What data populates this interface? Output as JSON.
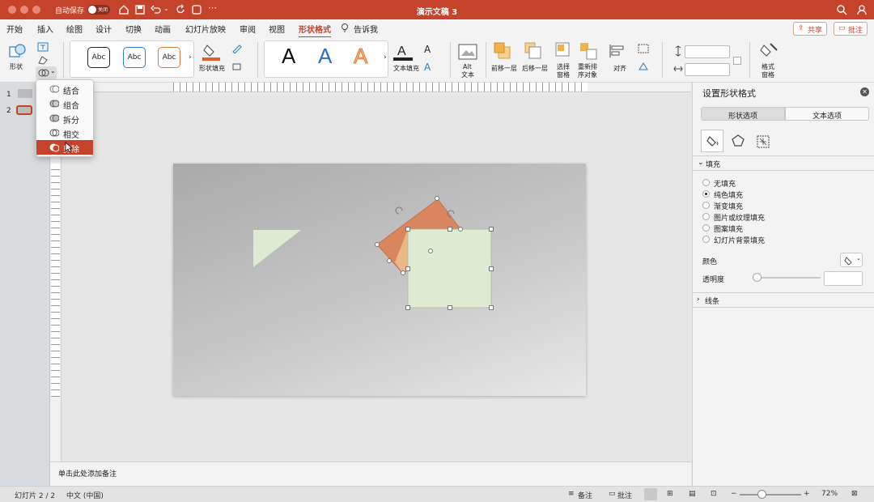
{
  "titlebar": {
    "autosave_label": "自动保存",
    "autosave_toggle": "关闭",
    "title": "演示文稿 3"
  },
  "tabs": [
    {
      "label": "开始"
    },
    {
      "label": "插入"
    },
    {
      "label": "绘图"
    },
    {
      "label": "设计"
    },
    {
      "label": "切换"
    },
    {
      "label": "动画"
    },
    {
      "label": "幻灯片放映"
    },
    {
      "label": "审阅"
    },
    {
      "label": "视图"
    },
    {
      "label": "形状格式"
    },
    {
      "label": "告诉我"
    }
  ],
  "header_actions": {
    "share": "共享",
    "comments": "批注"
  },
  "ribbon": {
    "shapes_label": "形状",
    "style_abc": [
      "Abc",
      "Abc",
      "Abc"
    ],
    "shape_fill_label": "形状填充",
    "text_fill_label": "文本填充",
    "wordart_letters": [
      "A",
      "A",
      "A"
    ],
    "alt_text_label_1": "Alt",
    "alt_text_label_2": "文本",
    "bring_forward_label": "前移一层",
    "send_backward_label": "后移一层",
    "selection_pane_label_1": "选择",
    "selection_pane_label_2": "窗格",
    "reorder_label_1": "重新排",
    "reorder_label_2": "序对象",
    "align_label": "对齐",
    "format_pane_label_1": "格式",
    "format_pane_label_2": "窗格"
  },
  "merge_menu": {
    "items": [
      {
        "label": "结合"
      },
      {
        "label": "组合"
      },
      {
        "label": "拆分"
      },
      {
        "label": "相交"
      },
      {
        "label": "剪除"
      }
    ],
    "highlighted_index": 4
  },
  "thumbs": {
    "numbers": [
      "1",
      "2"
    ]
  },
  "notes_placeholder": "单击此处添加备注",
  "format_pane": {
    "title": "设置形状格式",
    "tab_shape": "形状选项",
    "tab_text": "文本选项",
    "fill_section": "填充",
    "fill_options": [
      "无填充",
      "纯色填充",
      "渐变填充",
      "图片或纹理填充",
      "图案填充",
      "幻灯片背景填充"
    ],
    "selected_fill": 1,
    "color_label": "颜色",
    "transparency_label": "透明度",
    "line_section": "线条"
  },
  "status": {
    "slide_info": "幻灯片 2 / 2",
    "language": "中文 (中国)",
    "notes_btn": "备注",
    "comments_btn": "批注",
    "zoom": "72%"
  },
  "colors": {
    "accent": "#c5432a",
    "shape_orange": "#d9865f",
    "shape_green": "#dcebd2"
  }
}
